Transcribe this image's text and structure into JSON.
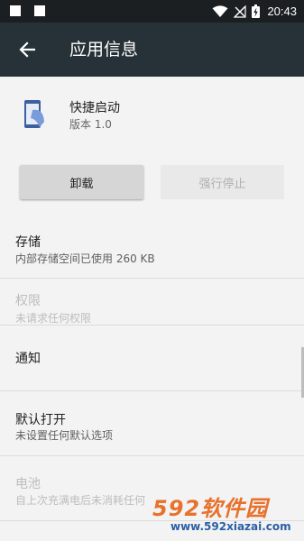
{
  "status_bar": {
    "time": "20:43"
  },
  "app_bar": {
    "title": "应用信息"
  },
  "app": {
    "name": "快捷启动",
    "version": "版本 1.0"
  },
  "buttons": {
    "uninstall": "卸载",
    "force_stop": "强行停止"
  },
  "rows": [
    {
      "title": "存储",
      "subtitle": "内部存储空间已使用 260 KB",
      "enabled": true
    },
    {
      "title": "权限",
      "subtitle": "未请求任何权限",
      "enabled": false
    },
    {
      "title": "通知",
      "subtitle": "",
      "enabled": true
    },
    {
      "title": "默认打开",
      "subtitle": "未设置任何默认选项",
      "enabled": true
    },
    {
      "title": "电池",
      "subtitle": "自上次充满电后未消耗任何",
      "enabled": false
    }
  ],
  "watermark": {
    "title": "592软件园",
    "url": "www.592xiazai.com"
  }
}
